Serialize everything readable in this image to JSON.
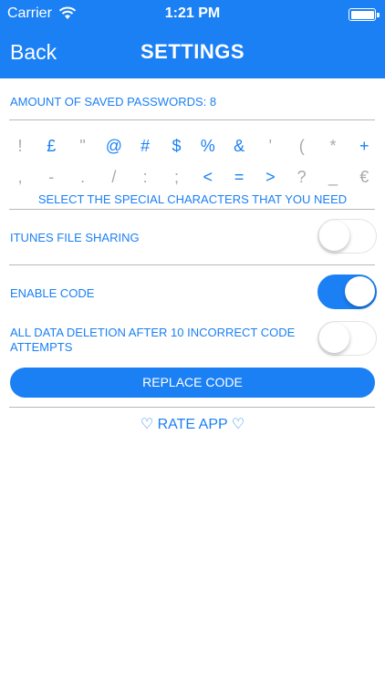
{
  "status_bar": {
    "carrier": "Carrier",
    "time": "1:21 PM"
  },
  "nav": {
    "back": "Back",
    "title": "SETTINGS"
  },
  "saved": {
    "label": "AMOUNT OF SAVED PASSWORDS: 8"
  },
  "special_chars": {
    "row1": [
      {
        "ch": "!",
        "on": false
      },
      {
        "ch": "£",
        "on": true
      },
      {
        "ch": "\"",
        "on": false
      },
      {
        "ch": "@",
        "on": true
      },
      {
        "ch": "#",
        "on": true
      },
      {
        "ch": "$",
        "on": true
      },
      {
        "ch": "%",
        "on": true
      },
      {
        "ch": "&",
        "on": true
      },
      {
        "ch": "'",
        "on": false
      },
      {
        "ch": "(",
        "on": false
      },
      {
        "ch": "*",
        "on": false
      },
      {
        "ch": "+",
        "on": true
      }
    ],
    "row2": [
      {
        "ch": ",",
        "on": false
      },
      {
        "ch": "-",
        "on": false
      },
      {
        "ch": ".",
        "on": false
      },
      {
        "ch": "/",
        "on": false
      },
      {
        "ch": ":",
        "on": false
      },
      {
        "ch": ";",
        "on": false
      },
      {
        "ch": "<",
        "on": true
      },
      {
        "ch": "=",
        "on": true
      },
      {
        "ch": ">",
        "on": true
      },
      {
        "ch": "?",
        "on": false
      },
      {
        "ch": "_",
        "on": false
      },
      {
        "ch": "€",
        "on": false
      }
    ],
    "note": "SELECT THE SPECIAL CHARACTERS THAT YOU NEED"
  },
  "settings": {
    "itunes": {
      "label": "iTUNES FILE SHARING",
      "on": false
    },
    "enable_code": {
      "label": "ENABLE CODE",
      "on": true
    },
    "deletion": {
      "label": "ALL DATA DELETION AFTER 10 INCORRECT CODE ATTEMPTS",
      "on": false
    }
  },
  "buttons": {
    "replace_code": "REPLACE CODE",
    "rate_app": "♡ RATE APP ♡"
  },
  "colors": {
    "accent": "#1b80f4",
    "inactive_char": "#a9a9a9",
    "divider": "#b8b8b8"
  },
  "icons": {
    "wifi": "wifi-icon",
    "battery": "battery-icon"
  }
}
